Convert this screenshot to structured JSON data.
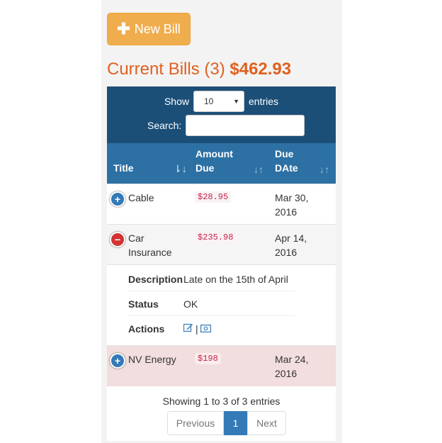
{
  "new_bill_button": {
    "icon": "plus-icon",
    "label": "New Bill"
  },
  "heading": {
    "title": "Current Bills (3)",
    "total": "$462.93"
  },
  "controls": {
    "show_label": "Show",
    "entries_value": "10",
    "entries_label": "entries",
    "search_label": "Search:"
  },
  "columns": [
    {
      "label": "Title"
    },
    {
      "label": "Amount Due"
    },
    {
      "label": "Due DAte"
    }
  ],
  "rows": [
    {
      "title": "Cable",
      "amount": "$28.95",
      "due": "Mar 30, 2016",
      "toggle": "+"
    },
    {
      "title": "Car Insurance",
      "amount": "$235.98",
      "due": "Apr 14, 2016",
      "toggle": "−"
    },
    {
      "title": "NV Energy",
      "amount": "$198",
      "due": "Mar 24, 2016",
      "toggle": "+"
    }
  ],
  "detail": {
    "description_label": "Description",
    "description_value": "Late on the 15th of April",
    "status_label": "Status",
    "status_value": "OK",
    "actions_label": "Actions",
    "actions_separator": "|"
  },
  "footer": {
    "info": "Showing 1 to 3 of 3 entries",
    "prev": "Previous",
    "page": "1",
    "next": "Next"
  },
  "colors": {
    "accent_orange": "#f0ad4e",
    "heading_orange": "#e0601e",
    "header_dark": "#1c4f78",
    "header_blue": "#2d70a4",
    "row_highlight": "#f2dede",
    "primary": "#337ab7"
  }
}
